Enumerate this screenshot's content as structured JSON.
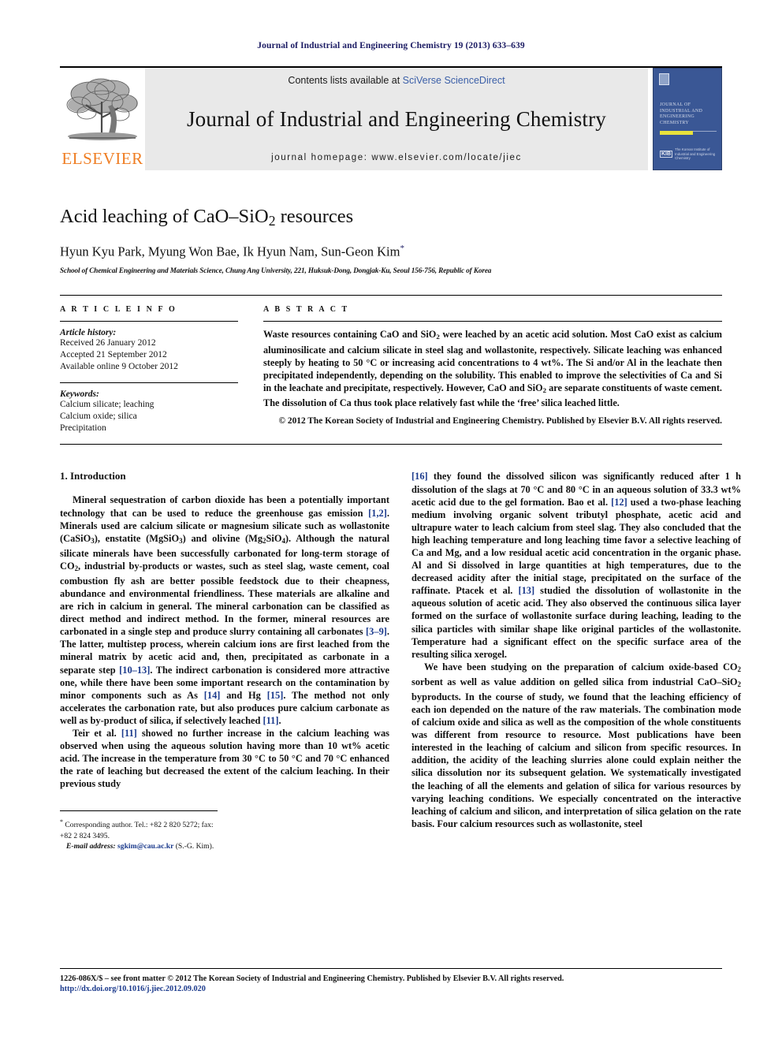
{
  "running_head": "Journal of Industrial and Engineering Chemistry 19 (2013) 633–639",
  "masthead": {
    "contents_prefix": "Contents lists available at ",
    "sciencedirect": "SciVerse ScienceDirect",
    "journal_title": "Journal of Industrial and Engineering Chemistry",
    "homepage": "journal homepage: www.elsevier.com/locate/jiec",
    "publisher_wordmark": "ELSEVIER",
    "publisher_color": "#ef7d22",
    "cover": {
      "title_lines": "Journal of Industrial and Engineering Chemistry",
      "society": "The Korean Institute of Industrial and Engineering Chemistry",
      "society_mark": "KIB",
      "bg_color": "#3a5795",
      "accent_color": "#e8e23c"
    }
  },
  "article": {
    "title": "Acid leaching of CaO–SiO2 resources",
    "title_main_a": "Acid leaching of CaO–SiO",
    "title_sub": "2",
    "title_main_b": " resources",
    "authors": "Hyun Kyu Park, Myung Won Bae, Ik Hyun Nam, Sun-Geon Kim",
    "corresponding_marker": "*",
    "affiliation": "School of Chemical Engineering and Materials Science, Chung Ang University, 221, Huksuk-Dong, Dongjak-Ku, Seoul 156-756, Republic of Korea"
  },
  "article_info": {
    "heading": "A R T I C L E   I N F O",
    "history_label": "Article history:",
    "history": [
      "Received 26 January 2012",
      "Accepted 21 September 2012",
      "Available online 9 October 2012"
    ],
    "keywords_label": "Keywords:",
    "keywords": [
      "Calcium silicate; leaching",
      "Calcium oxide; silica",
      "Precipitation"
    ]
  },
  "abstract": {
    "heading": "A B S T R A C T",
    "body_1": "Waste resources containing CaO and SiO",
    "body_sub1": "2",
    "body_2": " were leached by an acetic acid solution. Most CaO exist as calcium aluminosilicate and calcium silicate in steel slag and wollastonite, respectively. Silicate leaching was enhanced steeply by heating to 50 °C or increasing acid concentrations to 4 wt%. The Si and/or Al in the leachate then precipitated independently, depending on the solubility. This enabled to improve the selectivities of Ca and Si in the leachate and precipitate, respectively. However, CaO and SiO",
    "body_sub2": "2",
    "body_3": " are separate constituents of waste cement. The dissolution of Ca thus took place relatively fast while the ‘free’ silica leached little.",
    "copyright": "© 2012 The Korean Society of Industrial and Engineering Chemistry. Published by Elsevier B.V. All rights reserved."
  },
  "intro": {
    "heading": "1. Introduction",
    "p1_a": "Mineral sequestration of carbon dioxide has been a potentially important technology that can be used to reduce the greenhouse gas emission ",
    "p1_ref1": "[1,2]",
    "p1_b": ". Minerals used are calcium silicate or magnesium silicate such as wollastonite (CaSiO",
    "p1_sub1": "3",
    "p1_c": "), enstatite (MgSiO",
    "p1_sub2": "3",
    "p1_d": ") and olivine (Mg",
    "p1_sub3": "2",
    "p1_e": "SiO",
    "p1_sub4": "4",
    "p1_f": "). Although the natural silicate minerals have been successfully carbonated for long-term storage of CO",
    "p1_sub5": "2",
    "p1_g": ", industrial by-products or wastes, such as steel slag, waste cement, coal combustion fly ash are better possible feedstock due to their cheapness, abundance and environmental friendliness. These materials are alkaline and are rich in calcium in general. The mineral carbonation can be classified as direct method and indirect method. In the former, mineral resources are carbonated in a single step and produce slurry containing all carbonates ",
    "p1_ref2": "[3–9]",
    "p1_h": ". The latter, multistep process, wherein calcium ions are first leached from the mineral matrix by acetic acid and, then, precipitated as carbonate in a separate step ",
    "p1_ref3": "[10–13]",
    "p1_i": ". The indirect carbonation is considered more attractive one, while there have been some important research on the contamination by minor components such as As ",
    "p1_ref4": "[14]",
    "p1_j": " and Hg ",
    "p1_ref5": "[15]",
    "p1_k": ". The method not only accelerates the carbonation rate, but also produces pure calcium carbonate as well as by-product of silica, if selectively leached ",
    "p1_ref6": "[11]",
    "p1_l": ".",
    "p2_a": "Teir et al. ",
    "p2_ref1": "[11]",
    "p2_b": " showed no further increase in the calcium leaching was observed when using the aqueous solution having more than 10 wt% acetic acid. The increase in the temperature from 30 °C to 50 °C and 70 °C enhanced the rate of leaching but decreased the extent of the calcium leaching. In their previous study ",
    "p2_ref2": "[16]",
    "p2_c": " they found the dissolved silicon was significantly reduced after 1 h dissolution of the slags at 70 °C and 80 °C in an aqueous solution of 33.3 wt% acetic acid due to the gel formation. Bao et al. ",
    "p2_ref3": "[12]",
    "p2_d": " used a two-phase leaching medium involving organic solvent tributyl phosphate, acetic acid and ultrapure water to leach calcium from steel slag. They also concluded that the high leaching temperature and long leaching time favor a selective leaching of Ca and Mg, and a low residual acetic acid concentration in the organic phase. Al and Si dissolved in large quantities at high temperatures, due to the decreased acidity after the initial stage, precipitated on the surface of the raffinate. Ptacek et al. ",
    "p2_ref4": "[13]",
    "p2_e": " studied the dissolution of wollastonite in the aqueous solution of acetic acid. They also observed the continuous silica layer formed on the surface of wollastonite surface during leaching, leading to the silica particles with similar shape like original particles of the wollastonite. Temperature had a significant effect on the specific surface area of the resulting silica xerogel.",
    "p3_a": "We have been studying on the preparation of calcium oxide-based CO",
    "p3_sub1": "2",
    "p3_b": " sorbent as well as value addition on gelled silica from industrial CaO–SiO",
    "p3_sub2": "2",
    "p3_c": " byproducts. In the course of study, we found that the leaching efficiency of each ion depended on the nature of the raw materials. The combination mode of calcium oxide and silica as well as the composition of the whole constituents was different from resource to resource. Most publications have been interested in the leaching of calcium and silicon from specific resources. In addition, the acidity of the leaching slurries alone could explain neither the silica dissolution nor its subsequent gelation. We systematically investigated the leaching of all the elements and gelation of silica for various resources by varying leaching conditions. We especially concentrated on the interactive leaching of calcium and silicon, and interpretation of silica gelation on the rate basis. Four calcium resources such as wollastonite, steel"
  },
  "footnote": {
    "marker": "*",
    "line1": " Corresponding author. Tel.: +82 2 820 5272; fax: +82 2 824 3495.",
    "email_label": "E-mail address:",
    "email": "sgkim@cau.ac.kr",
    "email_owner": " (S.-G. Kim)."
  },
  "page_footer": {
    "line1": "1226-086X/$ – see front matter © 2012 The Korean Society of Industrial and Engineering Chemistry. Published by Elsevier B.V. All rights reserved.",
    "doi": "http://dx.doi.org/10.1016/j.jiec.2012.09.020"
  }
}
